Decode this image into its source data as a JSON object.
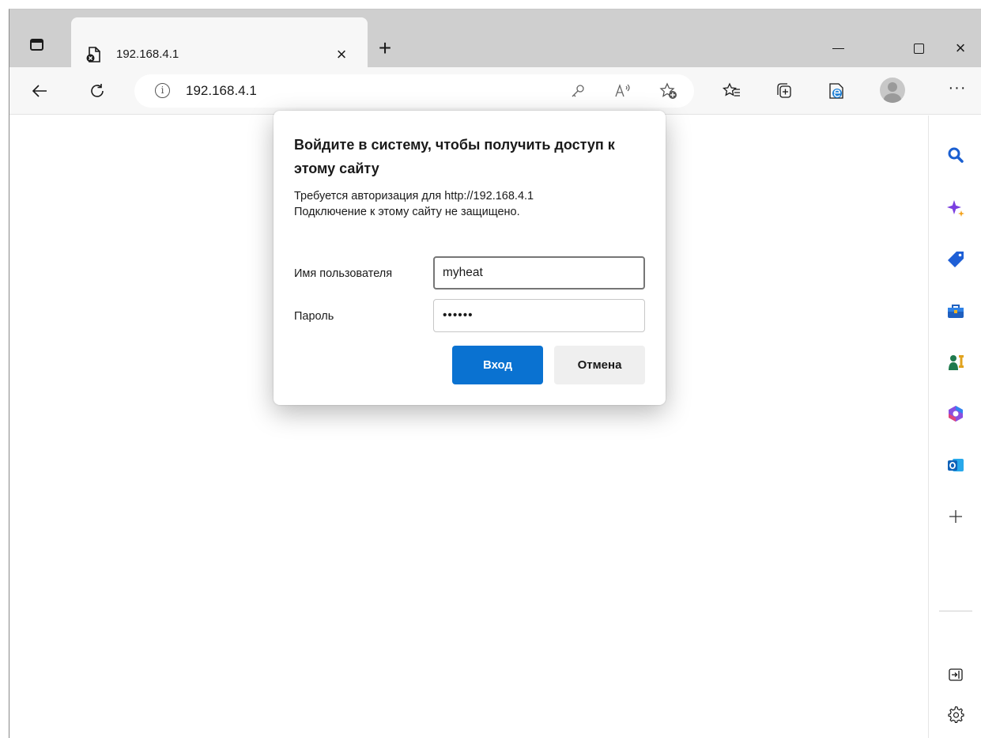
{
  "browser": {
    "tab": {
      "title": "192.168.4.1",
      "favicon": "insecure-page-icon",
      "close_label": "×"
    },
    "new_tab_label": "+",
    "window_controls": {
      "minimize": "minimize-icon",
      "maximize": "maximize-icon",
      "close_label": "×"
    },
    "address_bar": {
      "url": "192.168.4.1",
      "info_glyph": "i"
    },
    "toolbar_icons": [
      "back-arrow-icon",
      "refresh-icon",
      "key-icon",
      "read-aloud-icon",
      "add-favorite-icon",
      "favorites-icon",
      "collections-icon",
      "internet-explorer-mode-icon",
      "profile-avatar-icon"
    ],
    "more_label": "···",
    "sidebar": {
      "items": [
        "search-icon",
        "copilot-icon",
        "shopping-tag-icon",
        "tools-icon",
        "games-icon",
        "microsoft-365-icon",
        "outlook-icon",
        "add-icon"
      ],
      "bottom_items": [
        "hide-sidebar-icon",
        "settings-gear-icon"
      ]
    }
  },
  "dialog": {
    "title": "Войдите в систему, чтобы получить доступ к этому сайту",
    "message_line1": "Требуется авторизация для http://192.168.4.1",
    "message_line2": "Подключение к этому сайту не защищено.",
    "username_label": "Имя пользователя",
    "username_value": "myheat",
    "password_label": "Пароль",
    "password_value": "••••••",
    "login_button": "Вход",
    "cancel_button": "Отмена",
    "accent_color": "#0a72d1"
  }
}
